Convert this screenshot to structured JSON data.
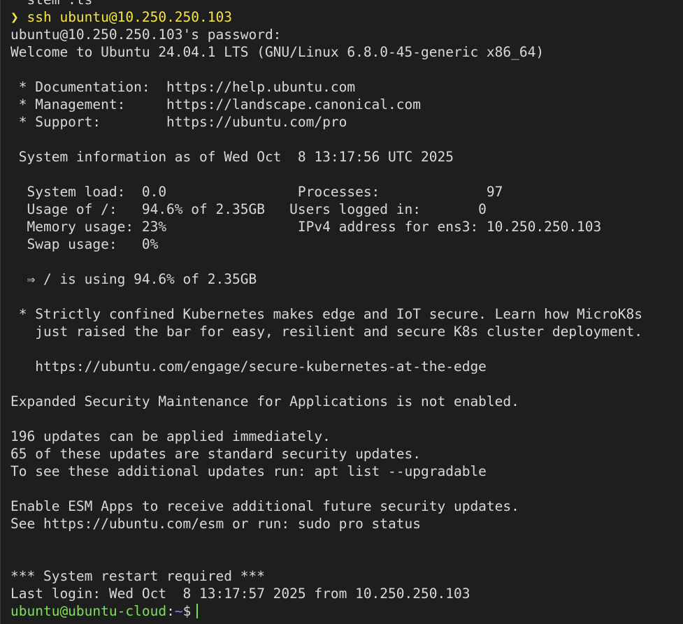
{
  "terminal": {
    "partial_top_line": "  stem .ts",
    "command": {
      "arrow": "❯",
      "text": " ssh ubuntu@10.250.250.103"
    },
    "lines": [
      "ubuntu@10.250.250.103's password:",
      "Welcome to Ubuntu 24.04.1 LTS (GNU/Linux 6.8.0-45-generic x86_64)",
      "",
      " * Documentation:  https://help.ubuntu.com",
      " * Management:     https://landscape.canonical.com",
      " * Support:        https://ubuntu.com/pro",
      "",
      " System information as of Wed Oct  8 13:17:56 UTC 2025",
      "",
      "  System load:  0.0                Processes:             97",
      "  Usage of /:   94.6% of 2.35GB   Users logged in:       0",
      "  Memory usage: 23%                IPv4 address for ens3: 10.250.250.103",
      "  Swap usage:   0%",
      "",
      "  ⇒ / is using 94.6% of 2.35GB",
      "",
      " * Strictly confined Kubernetes makes edge and IoT secure. Learn how MicroK8s",
      "   just raised the bar for easy, resilient and secure K8s cluster deployment.",
      "",
      "   https://ubuntu.com/engage/secure-kubernetes-at-the-edge",
      "",
      "Expanded Security Maintenance for Applications is not enabled.",
      "",
      "196 updates can be applied immediately.",
      "65 of these updates are standard security updates.",
      "To see these additional updates run: apt list --upgradable",
      "",
      "Enable ESM Apps to receive additional future security updates.",
      "See https://ubuntu.com/esm or run: sudo pro status",
      "",
      "",
      "*** System restart required ***",
      "Last login: Wed Oct  8 13:17:57 2025 from 10.250.250.103"
    ],
    "shell_prompt": {
      "user_host": "ubuntu@ubuntu-cloud",
      "separator": ":",
      "path": "~",
      "symbol": "$"
    },
    "colors": {
      "background": "#1e1e1e",
      "text": "#d9d9d9",
      "command": "#f5e642",
      "user_host": "#7ee05a",
      "path": "#6f8cff"
    }
  }
}
